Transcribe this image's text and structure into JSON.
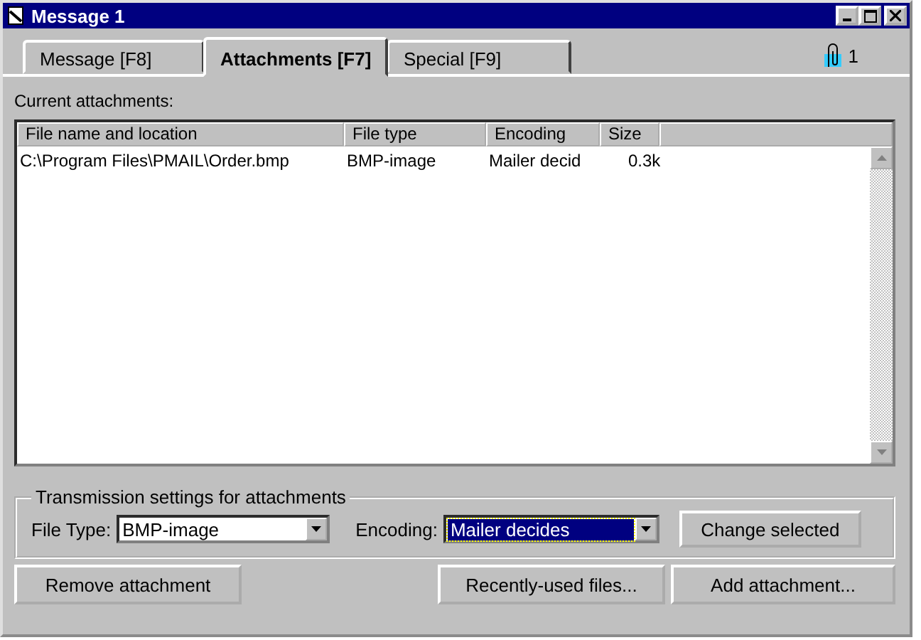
{
  "window": {
    "title": "Message 1"
  },
  "tabs": [
    {
      "label": "Message  [F8]",
      "selected": false
    },
    {
      "label": "Attachments  [F7]",
      "selected": true
    },
    {
      "label": "Special  [F9]",
      "selected": false
    }
  ],
  "attachment_count": "1",
  "list_label": "Current attachments:",
  "table": {
    "columns": [
      "File name and location",
      "File type",
      "Encoding",
      "Size"
    ],
    "rows": [
      {
        "cells": [
          "C:\\Program Files\\PMAIL\\Order.bmp",
          "BMP-image",
          "Mailer decid",
          "0.3k"
        ],
        "selected": false
      }
    ]
  },
  "settings": {
    "title": "Transmission settings for attachments",
    "file_type_label": "File Type:",
    "file_type": "BMP-image",
    "encoding_label": "Encoding:",
    "encoding": "Mailer decides",
    "encoding_focused": true,
    "change_button": "Change selected"
  },
  "buttons": [
    "Remove attachment",
    "Recently-used files...",
    "Add attachment..."
  ]
}
